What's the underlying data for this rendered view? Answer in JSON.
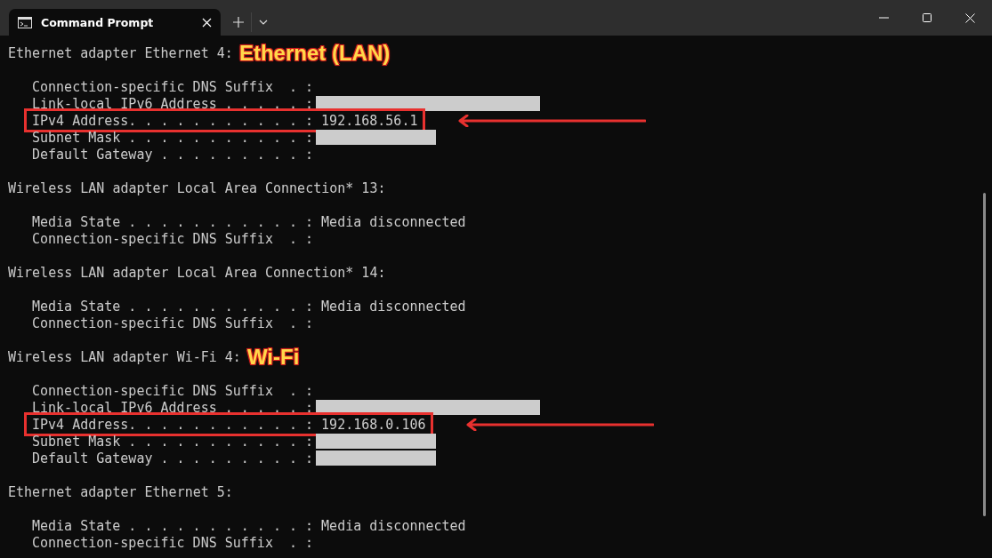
{
  "window": {
    "tab": {
      "title": "Command Prompt",
      "selected": true
    }
  },
  "lines": [
    {
      "kind": "heading",
      "text": "Ethernet adapter Ethernet 4:",
      "annotation": "Ethernet (LAN)"
    },
    {
      "kind": "blank"
    },
    {
      "kind": "field",
      "label": "Connection-specific DNS Suffix  . :"
    },
    {
      "kind": "wide_field",
      "label": "Link-local IPv6 Address . . . . . :",
      "redacted": true
    },
    {
      "kind": "field",
      "label": "IPv4 Address. . . . . . . . . . . :",
      "value": "192.168.56.1",
      "highlighted": true
    },
    {
      "kind": "field",
      "label": "Subnet Mask . . . . . . . . . . . :",
      "redacted": true
    },
    {
      "kind": "field",
      "label": "Default Gateway . . . . . . . . . :"
    },
    {
      "kind": "blank"
    },
    {
      "kind": "heading",
      "text": "Wireless LAN adapter Local Area Connection* 13:"
    },
    {
      "kind": "blank"
    },
    {
      "kind": "field",
      "label": "Media State . . . . . . . . . . . :",
      "value": "Media disconnected"
    },
    {
      "kind": "field",
      "label": "Connection-specific DNS Suffix  . :"
    },
    {
      "kind": "blank"
    },
    {
      "kind": "heading",
      "text": "Wireless LAN adapter Local Area Connection* 14:"
    },
    {
      "kind": "blank"
    },
    {
      "kind": "field",
      "label": "Media State . . . . . . . . . . . :",
      "value": "Media disconnected"
    },
    {
      "kind": "field",
      "label": "Connection-specific DNS Suffix  . :"
    },
    {
      "kind": "blank"
    },
    {
      "kind": "heading",
      "text": "Wireless LAN adapter Wi-Fi 4:",
      "annotation": "Wi-Fi"
    },
    {
      "kind": "blank"
    },
    {
      "kind": "field",
      "label": "Connection-specific DNS Suffix  . :"
    },
    {
      "kind": "wide_field",
      "label": "Link-local IPv6 Address . . . . . :",
      "redacted": true
    },
    {
      "kind": "field",
      "label": "IPv4 Address. . . . . . . . . . . :",
      "value": "192.168.0.106",
      "highlighted": true
    },
    {
      "kind": "field",
      "label": "Subnet Mask . . . . . . . . . . . :",
      "redacted": true
    },
    {
      "kind": "field",
      "label": "Default Gateway . . . . . . . . . :",
      "redacted": true
    },
    {
      "kind": "blank"
    },
    {
      "kind": "heading",
      "text": "Ethernet adapter Ethernet 5:"
    },
    {
      "kind": "blank"
    },
    {
      "kind": "field",
      "label": "Media State . . . . . . . . . . . :",
      "value": "Media disconnected"
    },
    {
      "kind": "field",
      "label": "Connection-specific DNS Suffix  . :"
    }
  ]
}
